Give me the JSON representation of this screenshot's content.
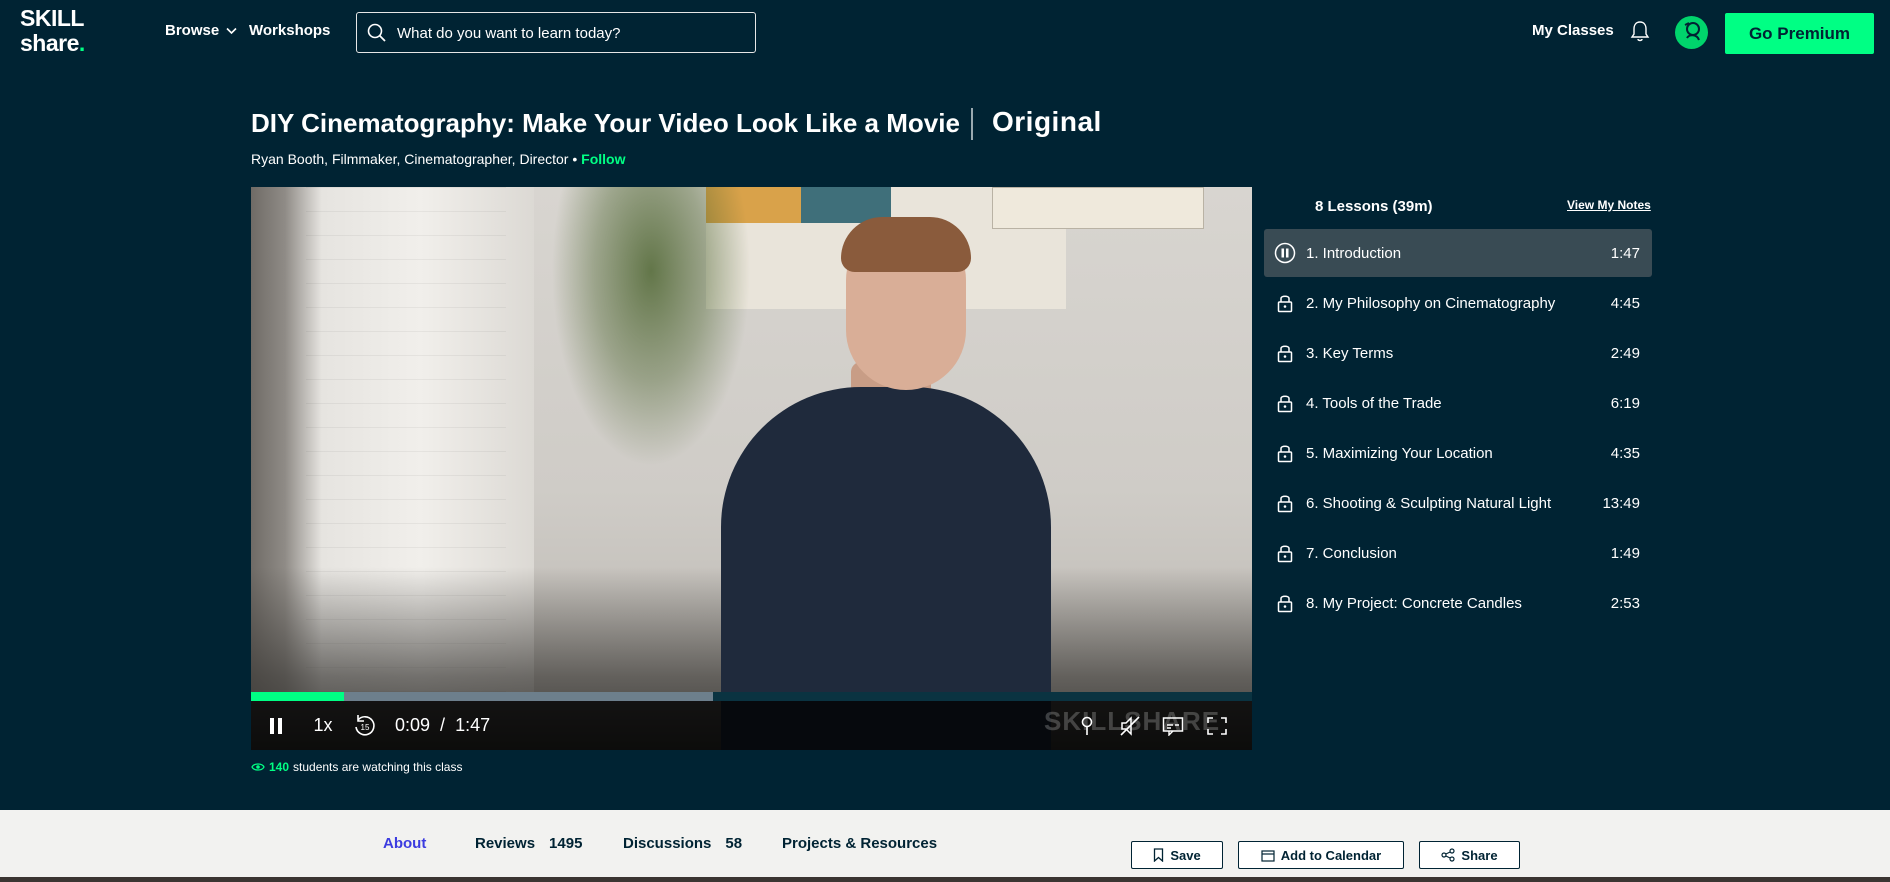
{
  "nav": {
    "logo_line1": "SKILL",
    "logo_line2": "share",
    "logo_dot": ".",
    "browse_label": "Browse",
    "workshops_label": "Workshops",
    "search_placeholder": "What do you want to learn today?",
    "my_classes_label": "My Classes",
    "premium_label": "Go Premium"
  },
  "course": {
    "title": "DIY Cinematography: Make Your Video Look Like a Movie",
    "badge": "Original",
    "teacher": "Ryan Booth, Filmmaker, Cinematographer, Director",
    "bullet": "•",
    "follow_label": "Follow"
  },
  "player": {
    "speed": "1x",
    "current_time": "0:09",
    "separator": "/",
    "duration": "1:47",
    "watermark": "SKILLSHARE",
    "played_fraction": 0.093,
    "buffered_fraction": 0.462
  },
  "watching": {
    "count": "140",
    "label": "students are watching this class"
  },
  "lessons": {
    "count_label": "8 Lessons (39m)",
    "view_notes_label": "View My Notes",
    "items": [
      {
        "title": "1. Introduction",
        "duration": "1:47",
        "state": "playing"
      },
      {
        "title": "2. My Philosophy on Cinematography",
        "duration": "4:45",
        "state": "locked"
      },
      {
        "title": "3. Key Terms",
        "duration": "2:49",
        "state": "locked"
      },
      {
        "title": "4. Tools of the Trade",
        "duration": "6:19",
        "state": "locked"
      },
      {
        "title": "5. Maximizing Your Location",
        "duration": "4:35",
        "state": "locked"
      },
      {
        "title": "6. Shooting & Sculpting Natural Light",
        "duration": "13:49",
        "state": "locked"
      },
      {
        "title": "7. Conclusion",
        "duration": "1:49",
        "state": "locked"
      },
      {
        "title": "8. My Project: Concrete Candles",
        "duration": "2:53",
        "state": "locked"
      }
    ]
  },
  "tabs": {
    "about": "About",
    "reviews": "Reviews",
    "reviews_count": "1495",
    "discussions": "Discussions",
    "discussions_count": "58",
    "projects": "Projects & Resources"
  },
  "actions": {
    "save": "Save",
    "calendar": "Add to Calendar",
    "share": "Share"
  },
  "colors": {
    "background": "#002333",
    "accent": "#00ff84",
    "active_tab": "#3c3ce0"
  }
}
